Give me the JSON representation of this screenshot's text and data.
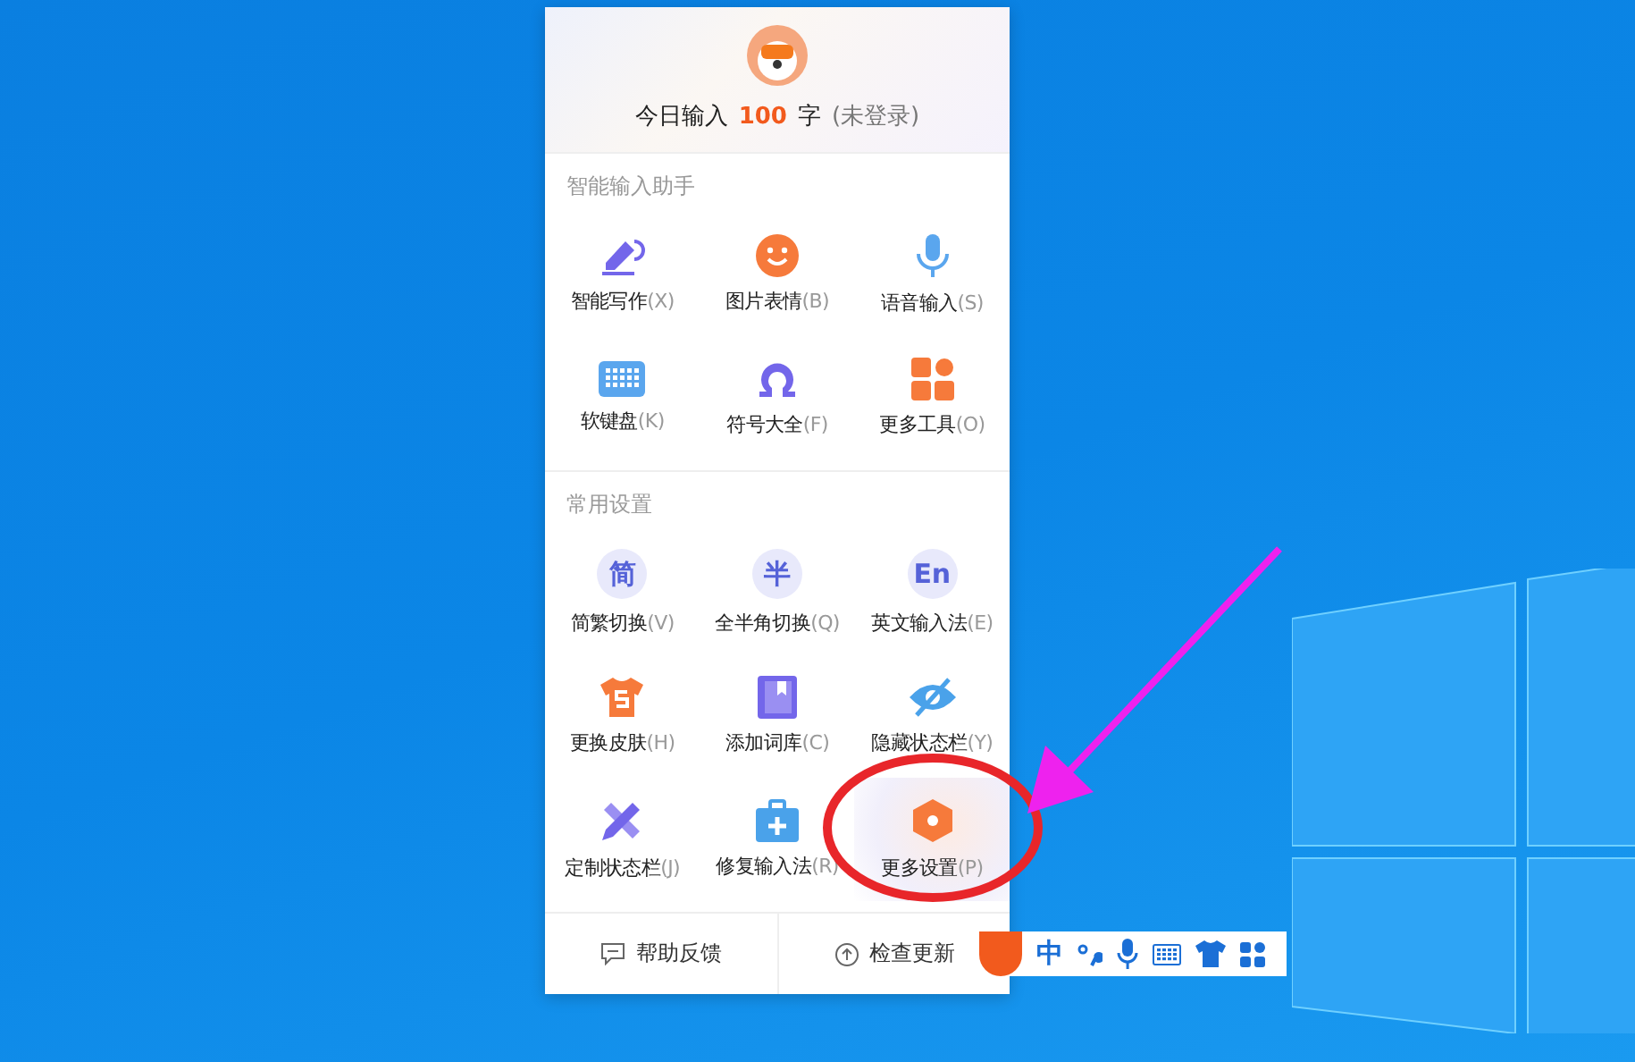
{
  "header": {
    "prefix": "今日输入",
    "count": "100",
    "suffix": "字",
    "status": "(未登录)"
  },
  "sections": [
    {
      "title": "智能输入助手",
      "items": [
        {
          "label": "智能写作",
          "shortcut": "(X)",
          "kind": "pen",
          "selected": false
        },
        {
          "label": "图片表情",
          "shortcut": "(B)",
          "kind": "smile",
          "selected": false
        },
        {
          "label": "语音输入",
          "shortcut": "(S)",
          "kind": "mic",
          "selected": false
        },
        {
          "label": "软键盘",
          "shortcut": "(K)",
          "kind": "keyboard",
          "selected": false
        },
        {
          "label": "符号大全",
          "shortcut": "(F)",
          "kind": "omega",
          "selected": false
        },
        {
          "label": "更多工具",
          "shortcut": "(O)",
          "kind": "tiles",
          "selected": false
        }
      ]
    },
    {
      "title": "常用设置",
      "items": [
        {
          "label": "简繁切换",
          "shortcut": "(V)",
          "kind": "glyph",
          "glyph": "简",
          "selected": false
        },
        {
          "label": "全半角切换",
          "shortcut": "(Q)",
          "kind": "glyph",
          "glyph": "半",
          "selected": false
        },
        {
          "label": "英文输入法",
          "shortcut": "(E)",
          "kind": "glyph",
          "glyph": "En",
          "selected": false
        },
        {
          "label": "更换皮肤",
          "shortcut": "(H)",
          "kind": "shirt",
          "selected": false
        },
        {
          "label": "添加词库",
          "shortcut": "(C)",
          "kind": "book",
          "selected": false
        },
        {
          "label": "隐藏状态栏",
          "shortcut": "(Y)",
          "kind": "eye",
          "selected": false
        },
        {
          "label": "定制状态栏",
          "shortcut": "(J)",
          "kind": "tools",
          "selected": false
        },
        {
          "label": "修复输入法",
          "shortcut": "(R)",
          "kind": "kit",
          "selected": false
        },
        {
          "label": "更多设置",
          "shortcut": "(P)",
          "kind": "hex",
          "selected": true
        }
      ]
    }
  ],
  "footer": [
    {
      "label": "帮助反馈",
      "kind": "chat"
    },
    {
      "label": "检查更新",
      "kind": "upload"
    }
  ],
  "toolbar": [
    {
      "kind": "text",
      "text": "中"
    },
    {
      "kind": "punct"
    },
    {
      "kind": "mic"
    },
    {
      "kind": "keyboard"
    },
    {
      "kind": "shirt"
    },
    {
      "kind": "grid"
    }
  ]
}
